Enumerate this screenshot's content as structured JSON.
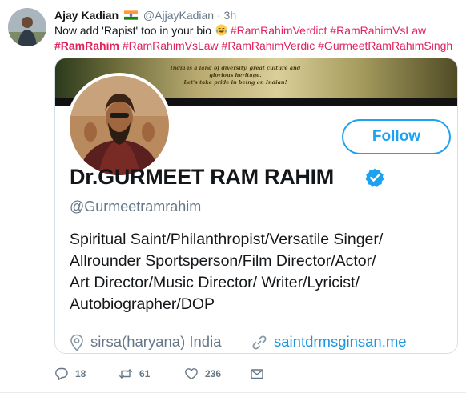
{
  "tweet": {
    "author_name": "Ajay Kadian",
    "handle": "@AjjayKadian",
    "separator": "·",
    "time": "3h",
    "text_prefix": "Now add 'Rapist' too in your bio",
    "hashtags_line1": [
      "#RamRahimVerdict",
      "#RamRahimVsLaw"
    ],
    "hashtag_bold": "#RamRahim",
    "hashtags_line2": [
      "#RamRahimVsLaw",
      "#RamRahimVerdic",
      "#GurmeetRamRahimSingh"
    ],
    "icons": {
      "flag": "india-flag-icon",
      "emoji": "tears-of-joy-emoji-icon"
    }
  },
  "embedded_profile": {
    "banner_text": [
      "India is a land of diversity, great culture and",
      "glorious heritage.",
      "Let's take pride in being an Indian!"
    ],
    "follow_label": "Follow",
    "name": "Dr.GURMEET RAM RAHIM",
    "handle": "@Gurmeetramrahim",
    "bio_lines": [
      "Spiritual Saint/Philanthropist/Versatile Singer/",
      "Allrounder Sportsperson/Film Director/Actor/",
      "Art Director/Music Director/ Writer/Lyricist/",
      "Autobiographer/DOP"
    ],
    "location": "sirsa(haryana) India",
    "website": "saintdrmsginsan.me",
    "icons": {
      "verified": "verified-badge-icon",
      "location": "location-pin-icon",
      "link": "link-icon"
    }
  },
  "actions": {
    "replies": "18",
    "retweets": "61",
    "likes": "236",
    "icons": [
      "reply-icon",
      "retweet-icon",
      "like-icon",
      "direct-message-icon"
    ]
  },
  "colors": {
    "hashtag": "#e0245e",
    "accent": "#1da1f2",
    "link": "#1b95e0",
    "secondary_text": "#657786"
  }
}
